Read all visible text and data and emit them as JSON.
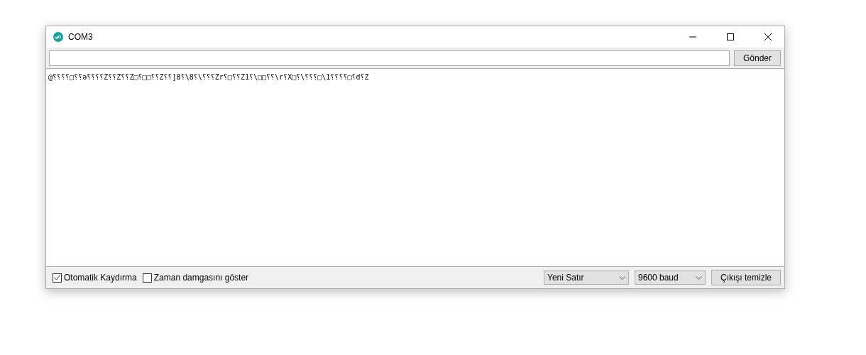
{
  "window": {
    "title": "COM3"
  },
  "send_button": "Gönder",
  "output": "@⸮⸮⸮⸮□⸮⸮ə⸮⸮⸮⸮Z⸮⸮Z⸮⸮Z□⸮□□⸮⸮Z⸮⸮]8⸮\\8⸮\\⸮⸮⸮Zr⸮□⸮⸮Z1⸮\\□□⸮⸮\\r⸮X□⸮\\⸮⸮⸮□\\1⸮⸮⸮⸮□⸮d⸮Z",
  "options": [
    {
      "label": "Otomatik Kaydırma",
      "checked": true
    },
    {
      "label": "Zaman damgasını göster",
      "checked": false
    }
  ],
  "dropdowns": [
    {
      "value": "Yeni Satır"
    },
    {
      "value": "9600 baud"
    }
  ],
  "clear_button": "Çıkışı temizle"
}
